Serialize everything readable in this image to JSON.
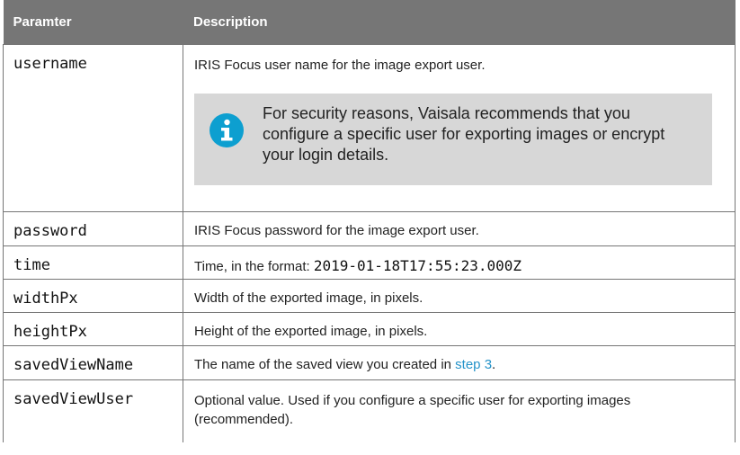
{
  "table": {
    "headers": [
      "Paramter",
      "Description"
    ],
    "rows": [
      {
        "param": "username",
        "description": "IRIS Focus user name for the image export user.",
        "note": {
          "icon": "info-icon",
          "text": "For security reasons, Vaisala recommends that you configure a specific user for exporting images or encrypt your login details."
        }
      },
      {
        "param": "password",
        "description": "IRIS Focus password for the image export user."
      },
      {
        "param": "time",
        "description_prefix": "Time, in the format: ",
        "description_code": "2019-01-18T17:55:23.000Z"
      },
      {
        "param": "widthPx",
        "description": "Width of the exported image, in pixels."
      },
      {
        "param": "heightPx",
        "description": "Height of the exported image, in pixels."
      },
      {
        "param": "savedViewName",
        "description_prefix": "The name of the saved view you created in ",
        "description_link": "step 3",
        "description_suffix": "."
      },
      {
        "param": "savedViewUser",
        "description": "Optional value. Used if you configure a specific user for exporting images (recommended)."
      }
    ]
  },
  "colors": {
    "header_bg": "#767676",
    "note_bg": "#d7d7d7",
    "info_icon": "#0d9fd0",
    "link": "#2593c9"
  }
}
